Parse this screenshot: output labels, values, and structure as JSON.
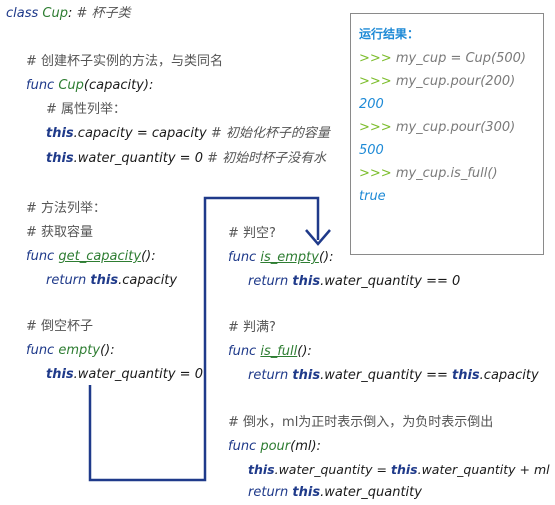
{
  "class_line": {
    "keyword": "class",
    "name": "Cup",
    "colon": ":",
    "comment": "# 杯子类"
  },
  "constructor": {
    "comment": "# 创建杯子实例的方法，与类同名",
    "keyword": "func",
    "name": "Cup",
    "params": "(capacity):",
    "attr_comment": "# 属性列举：",
    "line1": {
      "this": "this",
      "rest": ".capacity = capacity ",
      "comment": "# 初始化杯子的容量"
    },
    "line2": {
      "this": "this",
      "rest": ".water_quantity = 0 ",
      "comment": "# 初始时杯子没有水"
    }
  },
  "methods_comment": "# 方法列举：",
  "get_capacity": {
    "comment": "# 获取容量",
    "keyword": "func",
    "name": "get_capacity",
    "params": "():",
    "body": {
      "keyword": "return",
      "this": "this",
      "rest": ".capacity"
    }
  },
  "empty": {
    "comment": "# 倒空杯子",
    "keyword": "func",
    "name": "empty",
    "params": "():",
    "body": {
      "this": "this",
      "rest": ".water_quantity = 0"
    }
  },
  "is_empty": {
    "comment": "# 判空?",
    "keyword": "func",
    "name": "is_empty",
    "params": "():",
    "body": {
      "keyword": "return",
      "this": "this",
      "rest": ".water_quantity == 0"
    }
  },
  "is_full": {
    "comment": "# 判满?",
    "keyword": "func",
    "name": "is_full",
    "params": "():",
    "body": {
      "keyword": "return",
      "this": "this",
      "rest": ".water_quantity == ",
      "this2": "this",
      "rest2": ".capacity"
    }
  },
  "pour": {
    "comment": "# 倒水，ml为正时表示倒入，为负时表示倒出",
    "keyword": "func",
    "name": "pour",
    "params": "(ml):",
    "body1": {
      "this": "this",
      "mid": ".water_quantity = ",
      "this2": "this",
      "rest": ".water_quantity + ml"
    },
    "body2": {
      "keyword": "return",
      "this": "this",
      "rest": ".water_quantity"
    }
  },
  "result_box": {
    "title": "运行结果：",
    "lines": [
      {
        "prompt": ">>>",
        "text": " my_cup = Cup(500)"
      },
      {
        "prompt": ">>>",
        "text": " my_cup.pour(200)"
      },
      {
        "output": "200"
      },
      {
        "prompt": ">>>",
        "text": " my_cup.pour(300)"
      },
      {
        "output": "500"
      },
      {
        "prompt": ">>>",
        "text": " my_cup.is_full()"
      },
      {
        "output": "true"
      }
    ]
  },
  "colors": {
    "keyword": "#1f3a8a",
    "function": "#2e7d32",
    "result_title": "#1e8ad6",
    "prompt": "#7cbd2c",
    "output": "#1e8ad6",
    "arrow": "#1f3a8a"
  }
}
